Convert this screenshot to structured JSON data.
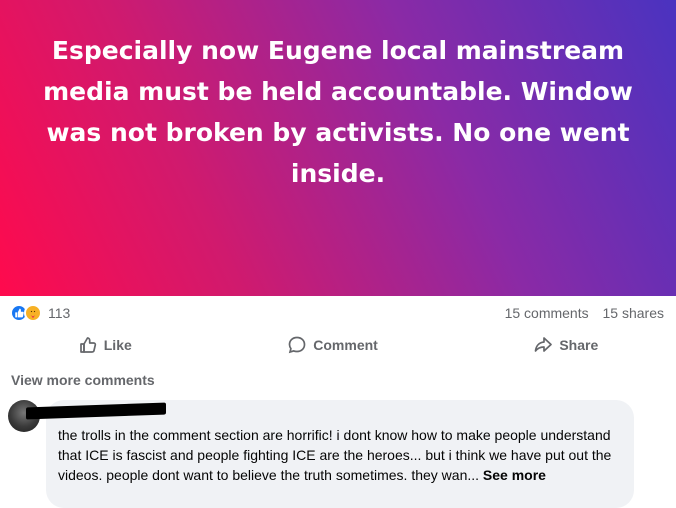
{
  "post": {
    "text": "Especially now Eugene local mainstream media must be held accountable. Window was not broken by activists. No one went inside."
  },
  "stats": {
    "reaction_count": "113",
    "comments": "15 comments",
    "shares": "15 shares",
    "reaction_icons": [
      "like-icon",
      "care-icon"
    ]
  },
  "actions": {
    "like": "Like",
    "comment": "Comment",
    "share": "Share"
  },
  "comments_section": {
    "view_more": "View more comments",
    "comment": {
      "text": "the trolls in the comment section are horrific! i dont know how to make people understand that ICE is fascist and people fighting ICE are the heroes... but i think we have put out the videos. people dont want to believe the truth sometimes. they wan... ",
      "see_more": "See more"
    }
  },
  "colors": {
    "gradient_start": "#ff0a4d",
    "gradient_end": "#4a33c0",
    "like_blue": "#1877f2",
    "muted_text": "#65676b"
  }
}
